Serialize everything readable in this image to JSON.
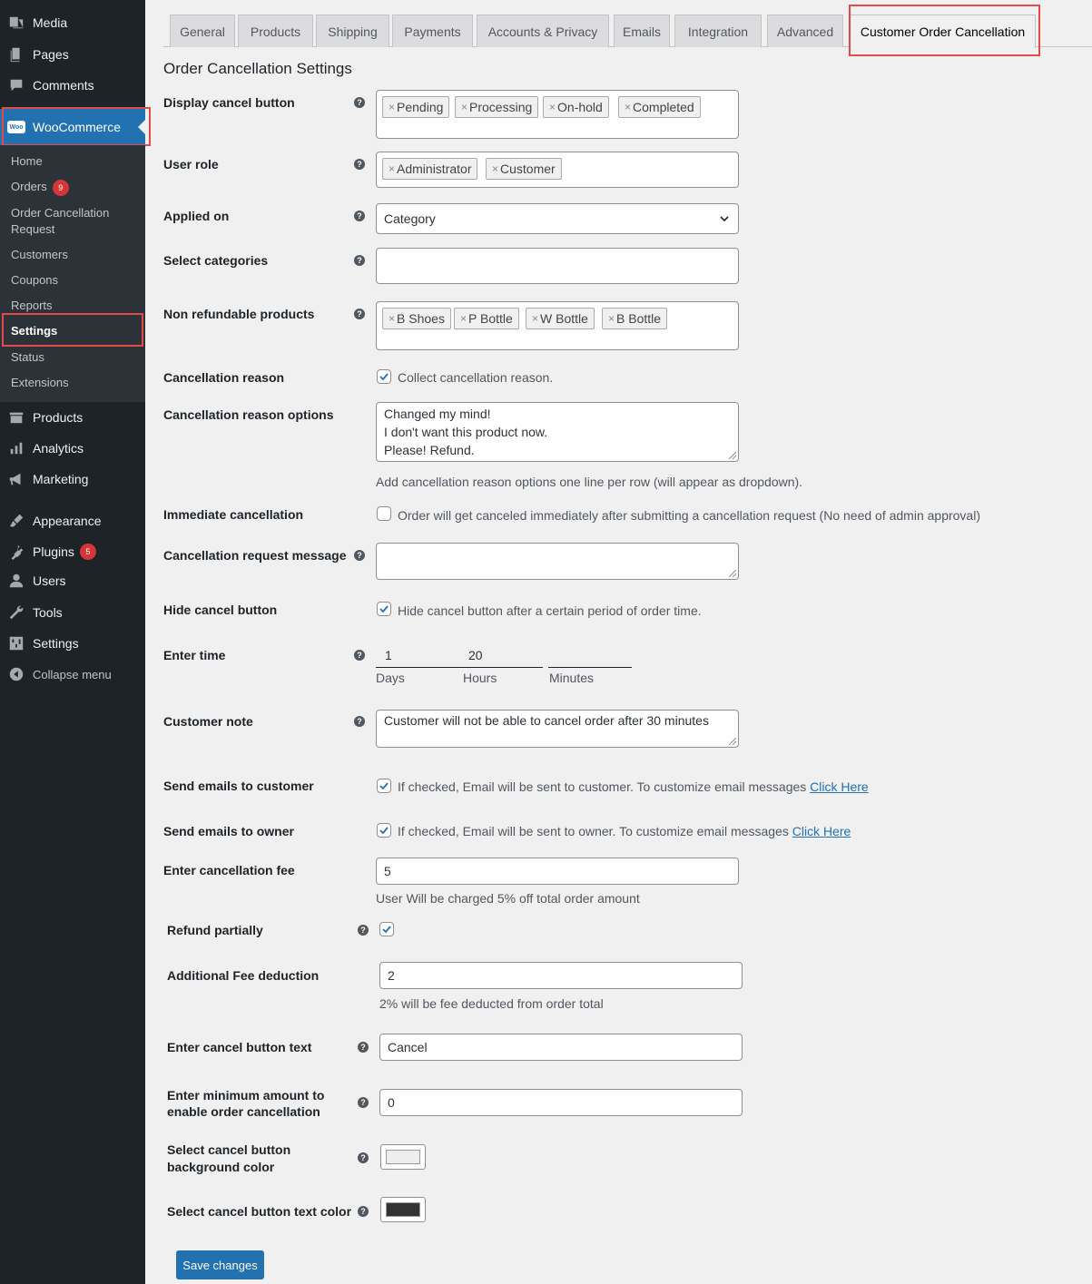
{
  "sidebar": {
    "top_items": [
      {
        "label": "Media",
        "icon": "media-icon"
      },
      {
        "label": "Pages",
        "icon": "pages-icon"
      },
      {
        "label": "Comments",
        "icon": "comments-icon"
      }
    ],
    "woocommerce": {
      "label": "WooCommerce",
      "logo_text": "Woo"
    },
    "woo_sub": [
      {
        "label": "Home"
      },
      {
        "label": "Orders",
        "badge": "9"
      },
      {
        "label": "Order Cancellation Request"
      },
      {
        "label": "Customers"
      },
      {
        "label": "Coupons"
      },
      {
        "label": "Reports"
      },
      {
        "label": "Settings",
        "current": true
      },
      {
        "label": "Status"
      },
      {
        "label": "Extensions"
      }
    ],
    "bottom_items": [
      {
        "label": "Products",
        "icon": "products-icon"
      },
      {
        "label": "Analytics",
        "icon": "analytics-icon"
      },
      {
        "label": "Marketing",
        "icon": "marketing-icon"
      },
      {
        "label": "Appearance",
        "icon": "appearance-icon"
      },
      {
        "label": "Plugins",
        "icon": "plugins-icon",
        "badge": "5"
      },
      {
        "label": "Users",
        "icon": "users-icon"
      },
      {
        "label": "Tools",
        "icon": "tools-icon"
      },
      {
        "label": "Settings",
        "icon": "settings-icon"
      },
      {
        "label": "Collapse menu",
        "icon": "collapse-icon"
      }
    ]
  },
  "tabs": [
    "General",
    "Products",
    "Shipping",
    "Payments",
    "Accounts & Privacy",
    "Emails",
    "Integration",
    "Advanced",
    "Customer Order Cancellation"
  ],
  "page_title": "Order Cancellation Settings",
  "fields": {
    "display_cancel_button": {
      "label": "Display cancel button",
      "chips": [
        "Pending",
        "Processing",
        "On-hold",
        "Completed"
      ]
    },
    "user_role": {
      "label": "User role",
      "chips": [
        "Administrator",
        "Customer"
      ]
    },
    "applied_on": {
      "label": "Applied on",
      "value": "Category"
    },
    "select_categories": {
      "label": "Select categories"
    },
    "non_refundable": {
      "label": "Non refundable products",
      "chips": [
        "B Shoes",
        "P Bottle",
        "W Bottle",
        "B Bottle"
      ]
    },
    "cancellation_reason": {
      "label": "Cancellation reason",
      "checkbox_text": "Collect cancellation reason.",
      "checked": true
    },
    "reason_options": {
      "label": "Cancellation reason options",
      "lines": [
        "Changed my mind!",
        "I don't want this product now.",
        "Please! Refund."
      ],
      "description": "Add cancellation reason options one line per row (will appear as dropdown)."
    },
    "immediate": {
      "label": "Immediate cancellation",
      "checkbox_text": "Order will get canceled immediately after submitting a cancellation request (No need of admin approval)",
      "checked": false
    },
    "request_message": {
      "label": "Cancellation request message"
    },
    "hide_cancel": {
      "label": "Hide cancel button",
      "checkbox_text": "Hide cancel button after a certain period of order time.",
      "checked": true
    },
    "enter_time": {
      "label": "Enter time",
      "days": "1",
      "hours": "20",
      "minutes": "",
      "days_label": "Days",
      "hours_label": "Hours",
      "minutes_label": "Minutes"
    },
    "customer_note": {
      "label": "Customer note",
      "value": "Customer will not be able to cancel order after 30 minutes"
    },
    "emails_customer": {
      "label": "Send emails to customer",
      "checkbox_text": "If checked, Email will be sent to customer. To customize email messages",
      "link": "Click Here",
      "checked": true
    },
    "emails_owner": {
      "label": "Send emails to owner",
      "checkbox_text": "If checked, Email will be sent to owner. To customize email messages",
      "link": "Click Here",
      "checked": true
    },
    "cancellation_fee": {
      "label": "Enter cancellation fee",
      "value": "5",
      "description": "User Will be charged 5% off total order amount"
    },
    "refund_partially": {
      "label": "Refund partially",
      "checked": true
    },
    "additional_fee": {
      "label": "Additional Fee deduction",
      "value": "2",
      "description": "2% will be fee deducted from order total"
    },
    "cancel_button_text": {
      "label": "Enter cancel button text",
      "value": "Cancel"
    },
    "min_amount": {
      "label_line1": "Enter minimum amount to",
      "label_line2": "enable order cancellation",
      "value": "0"
    },
    "bg_color": {
      "label_line1": "Select cancel button",
      "label_line2": "background color",
      "color": "#eeeeee"
    },
    "text_color": {
      "label": "Select cancel button text color",
      "color": "#333333"
    }
  },
  "save_button": "Save changes",
  "colors": {
    "accent": "#2271b1",
    "highlight": "#e34a4a",
    "sidebar": "#1d2327"
  }
}
